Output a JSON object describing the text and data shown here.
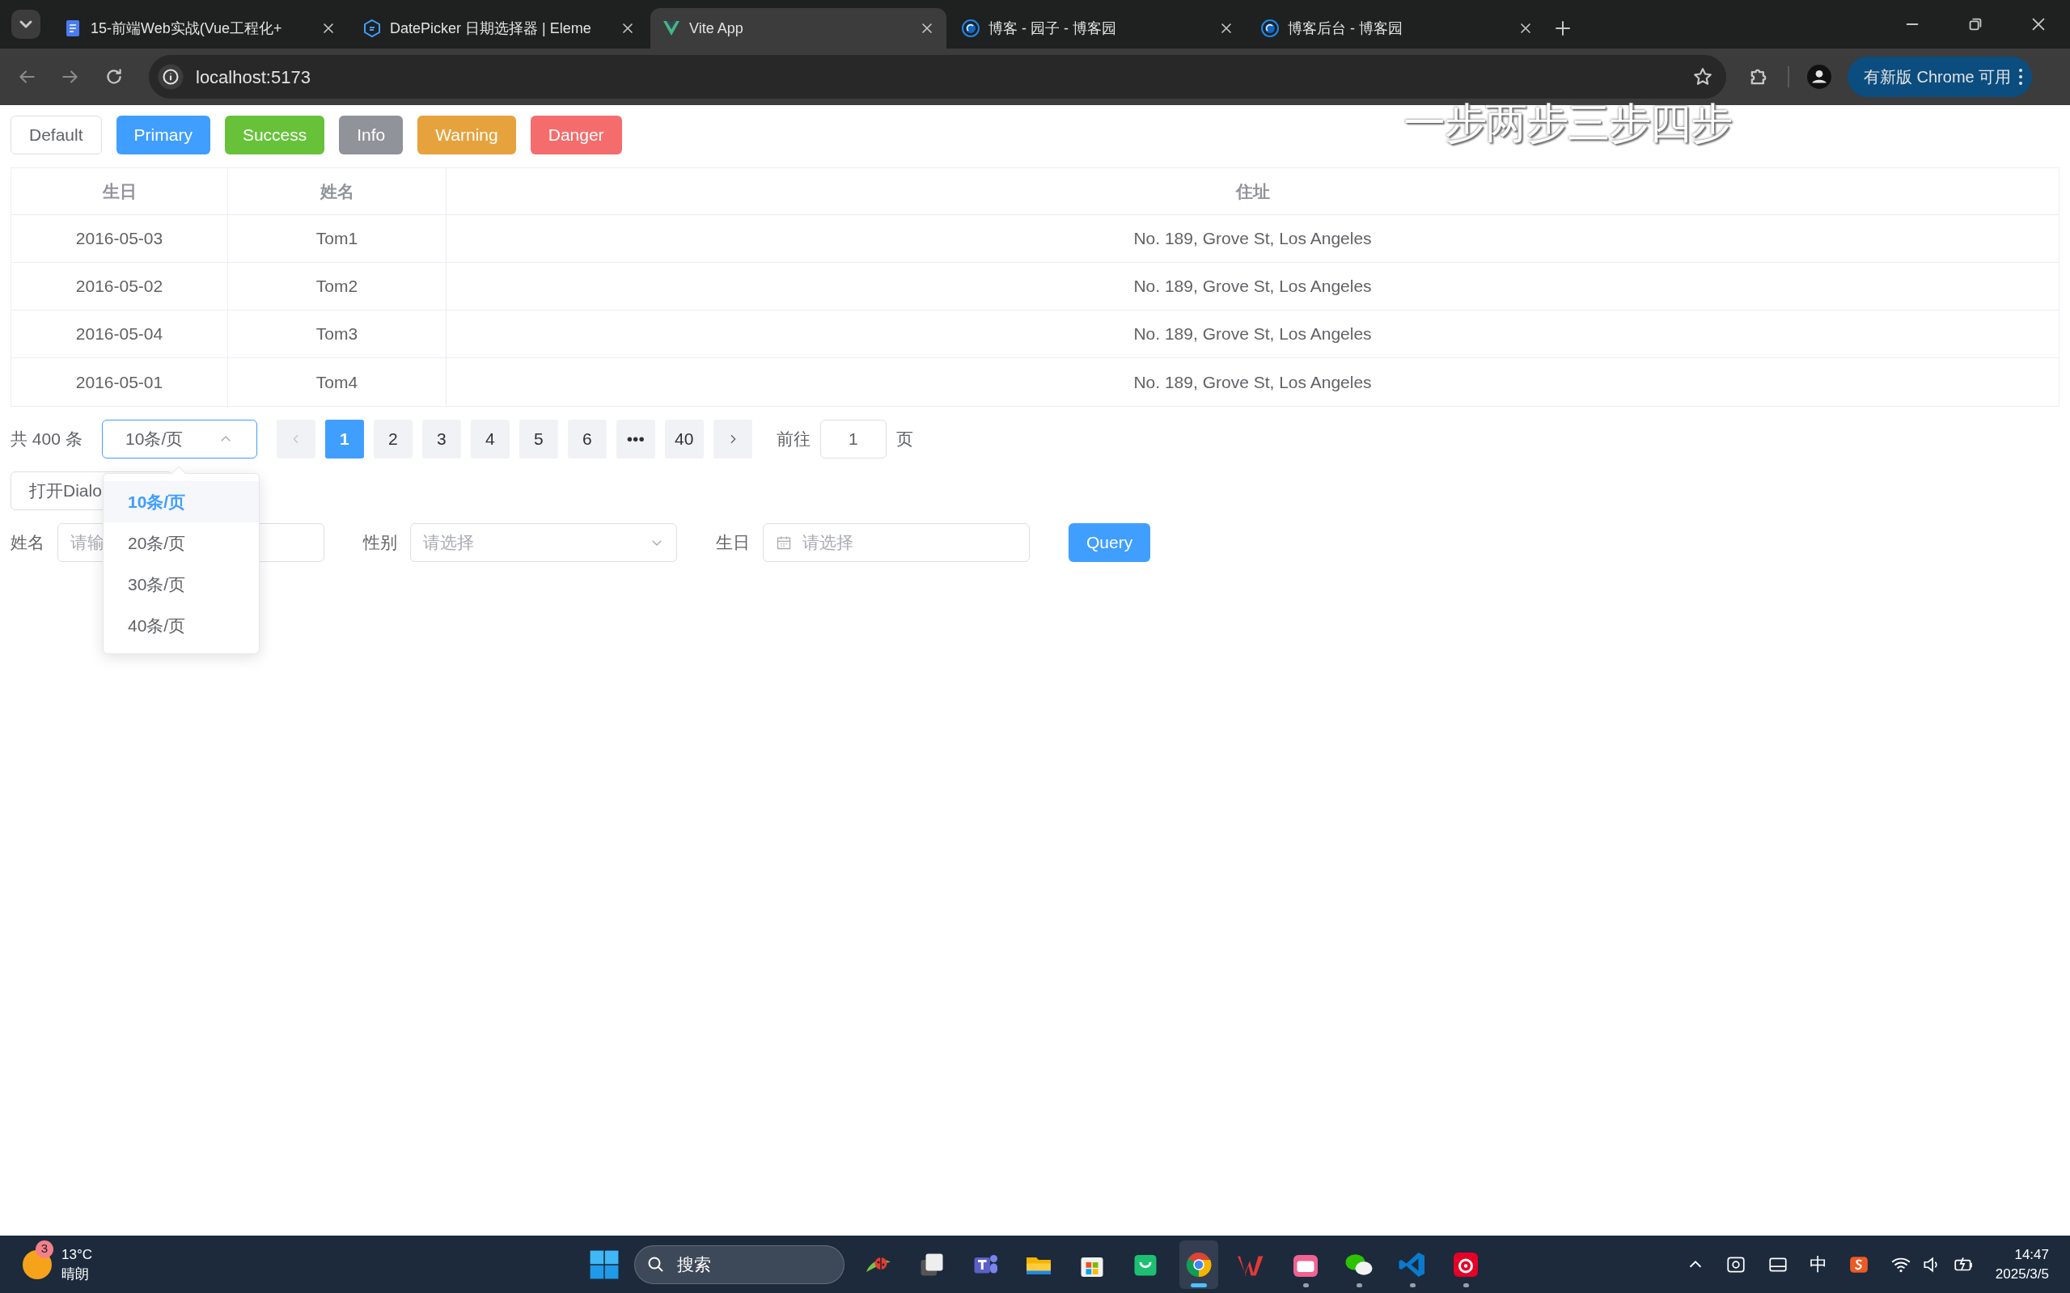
{
  "browser": {
    "tabs": [
      {
        "title": "15-前端Web实战(Vue工程化+",
        "kind": "doc",
        "selected": false
      },
      {
        "title": "DatePicker 日期选择器 | Eleme",
        "kind": "element",
        "selected": false
      },
      {
        "title": "Vite App",
        "kind": "vue",
        "selected": true
      },
      {
        "title": "博客 - 园子 - 博客园",
        "kind": "cnblogs",
        "selected": false
      },
      {
        "title": "博客后台 - 博客园",
        "kind": "cnblogs",
        "selected": false
      }
    ],
    "address": "localhost:5173",
    "update_button": "有新版 Chrome 可用"
  },
  "lyrics_overlay": "一步两步三步四步",
  "buttons": [
    {
      "label": "Default",
      "kind": "default"
    },
    {
      "label": "Primary",
      "kind": "primary"
    },
    {
      "label": "Success",
      "kind": "success"
    },
    {
      "label": "Info",
      "kind": "info"
    },
    {
      "label": "Warning",
      "kind": "warning"
    },
    {
      "label": "Danger",
      "kind": "danger"
    }
  ],
  "table": {
    "columns": [
      "生日",
      "姓名",
      "住址"
    ],
    "rows": [
      [
        "2016-05-03",
        "Tom1",
        "No. 189, Grove St, Los Angeles"
      ],
      [
        "2016-05-02",
        "Tom2",
        "No. 189, Grove St, Los Angeles"
      ],
      [
        "2016-05-04",
        "Tom3",
        "No. 189, Grove St, Los Angeles"
      ],
      [
        "2016-05-01",
        "Tom4",
        "No. 189, Grove St, Los Angeles"
      ]
    ]
  },
  "pagination": {
    "total": "共 400 条",
    "page_size": "10条/页",
    "pages": [
      {
        "label": "1",
        "selected": true
      },
      {
        "label": "2",
        "selected": false
      },
      {
        "label": "3",
        "selected": false
      },
      {
        "label": "4",
        "selected": false
      },
      {
        "label": "5",
        "selected": false
      },
      {
        "label": "6",
        "selected": false
      },
      {
        "label": "•••",
        "selected": false
      },
      {
        "label": "40",
        "selected": false
      }
    ],
    "goto_label": "前往",
    "goto_value": "1",
    "page_unit": "页"
  },
  "page_size_menu": {
    "expanded": true,
    "options": [
      {
        "label": "10条/页",
        "selected": true
      },
      {
        "label": "20条/页",
        "selected": false
      },
      {
        "label": "30条/页",
        "selected": false
      },
      {
        "label": "40条/页",
        "selected": false
      }
    ]
  },
  "dialog_button": "打开Dialo",
  "form": {
    "fields": [
      {
        "label": "姓名",
        "kind": "text",
        "placeholder": "请输"
      },
      {
        "label": "性别",
        "kind": "select",
        "placeholder": "请选择"
      },
      {
        "label": "生日",
        "kind": "date",
        "placeholder": "请选择"
      }
    ],
    "query": "Query"
  },
  "taskbar": {
    "weather": {
      "badge": "3",
      "temp": "13°C",
      "condition": "晴朗"
    },
    "search": "搜索",
    "apps": [
      {
        "kind": "ladybug",
        "running": false,
        "active": false
      },
      {
        "kind": "taskview",
        "running": false,
        "active": false
      },
      {
        "kind": "teams",
        "running": false,
        "active": false
      },
      {
        "kind": "explorer",
        "running": false,
        "active": false
      },
      {
        "kind": "store",
        "running": false,
        "active": false
      },
      {
        "kind": "bag",
        "running": false,
        "active": false
      },
      {
        "kind": "chrome",
        "running": true,
        "active": true
      },
      {
        "kind": "wps",
        "running": false,
        "active": false
      },
      {
        "kind": "bilibili",
        "running": true,
        "active": false
      },
      {
        "kind": "wechat",
        "running": true,
        "active": false
      },
      {
        "kind": "vscode",
        "running": true,
        "active": false
      },
      {
        "kind": "music",
        "running": true,
        "active": false
      }
    ],
    "ime": "中",
    "time": "14:47",
    "date": "2025/3/5"
  }
}
